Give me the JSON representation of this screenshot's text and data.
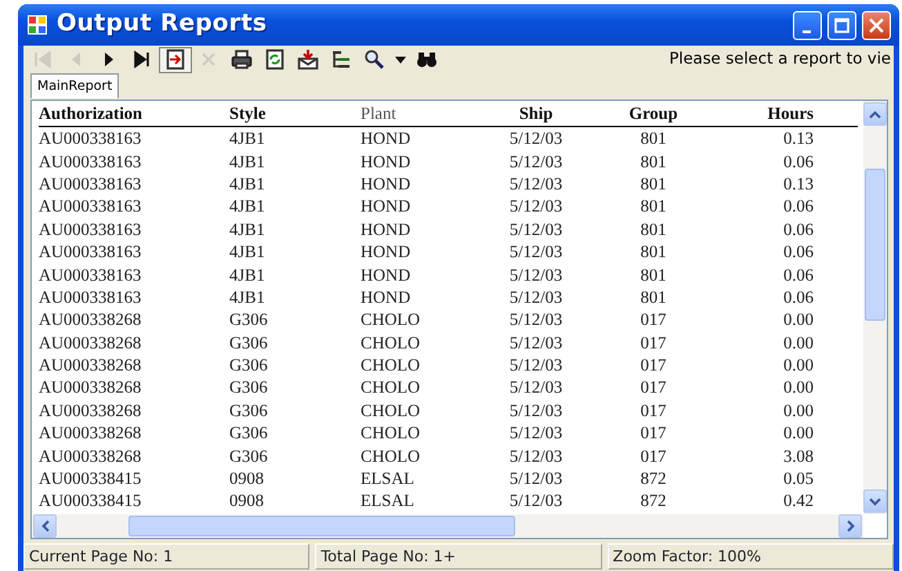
{
  "window": {
    "title": "Output Reports"
  },
  "toolbar": {
    "buttons": [
      {
        "kind": "first",
        "disabled": true
      },
      {
        "kind": "prev",
        "disabled": true
      },
      {
        "kind": "next",
        "disabled": false
      },
      {
        "kind": "last",
        "disabled": false
      },
      {
        "kind": "goto",
        "disabled": false
      },
      {
        "kind": "cancel",
        "disabled": true
      },
      {
        "kind": "print",
        "disabled": false
      },
      {
        "kind": "refresh",
        "disabled": false
      },
      {
        "kind": "export",
        "disabled": false
      },
      {
        "kind": "tree",
        "disabled": false
      },
      {
        "kind": "zoom",
        "disabled": false
      },
      {
        "kind": "caret",
        "disabled": false
      },
      {
        "kind": "find",
        "disabled": false
      }
    ],
    "message": "Please select a report to vie"
  },
  "tabs": [
    {
      "label": "MainReport",
      "selected": true
    }
  ],
  "table": {
    "columns": [
      {
        "label": "Authorization",
        "bold": true
      },
      {
        "label": "Style",
        "bold": true
      },
      {
        "label": "Plant",
        "bold": false
      },
      {
        "label": "Ship",
        "bold": true
      },
      {
        "label": "Group",
        "bold": true
      },
      {
        "label": "Hours",
        "bold": true
      }
    ],
    "rows": [
      [
        "AU000338163",
        "4JB1",
        "HOND",
        "5/12/03",
        "801",
        "0.13"
      ],
      [
        "AU000338163",
        "4JB1",
        "HOND",
        "5/12/03",
        "801",
        "0.06"
      ],
      [
        "AU000338163",
        "4JB1",
        "HOND",
        "5/12/03",
        "801",
        "0.13"
      ],
      [
        "AU000338163",
        "4JB1",
        "HOND",
        "5/12/03",
        "801",
        "0.06"
      ],
      [
        "AU000338163",
        "4JB1",
        "HOND",
        "5/12/03",
        "801",
        "0.06"
      ],
      [
        "AU000338163",
        "4JB1",
        "HOND",
        "5/12/03",
        "801",
        "0.06"
      ],
      [
        "AU000338163",
        "4JB1",
        "HOND",
        "5/12/03",
        "801",
        "0.06"
      ],
      [
        "AU000338163",
        "4JB1",
        "HOND",
        "5/12/03",
        "801",
        "0.06"
      ],
      [
        "AU000338268",
        "G306",
        "CHOLO",
        "5/12/03",
        "017",
        "0.00"
      ],
      [
        "AU000338268",
        "G306",
        "CHOLO",
        "5/12/03",
        "017",
        "0.00"
      ],
      [
        "AU000338268",
        "G306",
        "CHOLO",
        "5/12/03",
        "017",
        "0.00"
      ],
      [
        "AU000338268",
        "G306",
        "CHOLO",
        "5/12/03",
        "017",
        "0.00"
      ],
      [
        "AU000338268",
        "G306",
        "CHOLO",
        "5/12/03",
        "017",
        "0.00"
      ],
      [
        "AU000338268",
        "G306",
        "CHOLO",
        "5/12/03",
        "017",
        "0.00"
      ],
      [
        "AU000338268",
        "G306",
        "CHOLO",
        "5/12/03",
        "017",
        "3.08"
      ],
      [
        "AU000338415",
        "0908",
        "ELSAL",
        "5/12/03",
        "872",
        "0.05"
      ],
      [
        "AU000338415",
        "0908",
        "ELSAL",
        "5/12/03",
        "872",
        "0.42"
      ]
    ]
  },
  "status_bar": [
    "Current Page No: 1",
    "Total Page No: 1+",
    "Zoom Factor: 100%"
  ]
}
